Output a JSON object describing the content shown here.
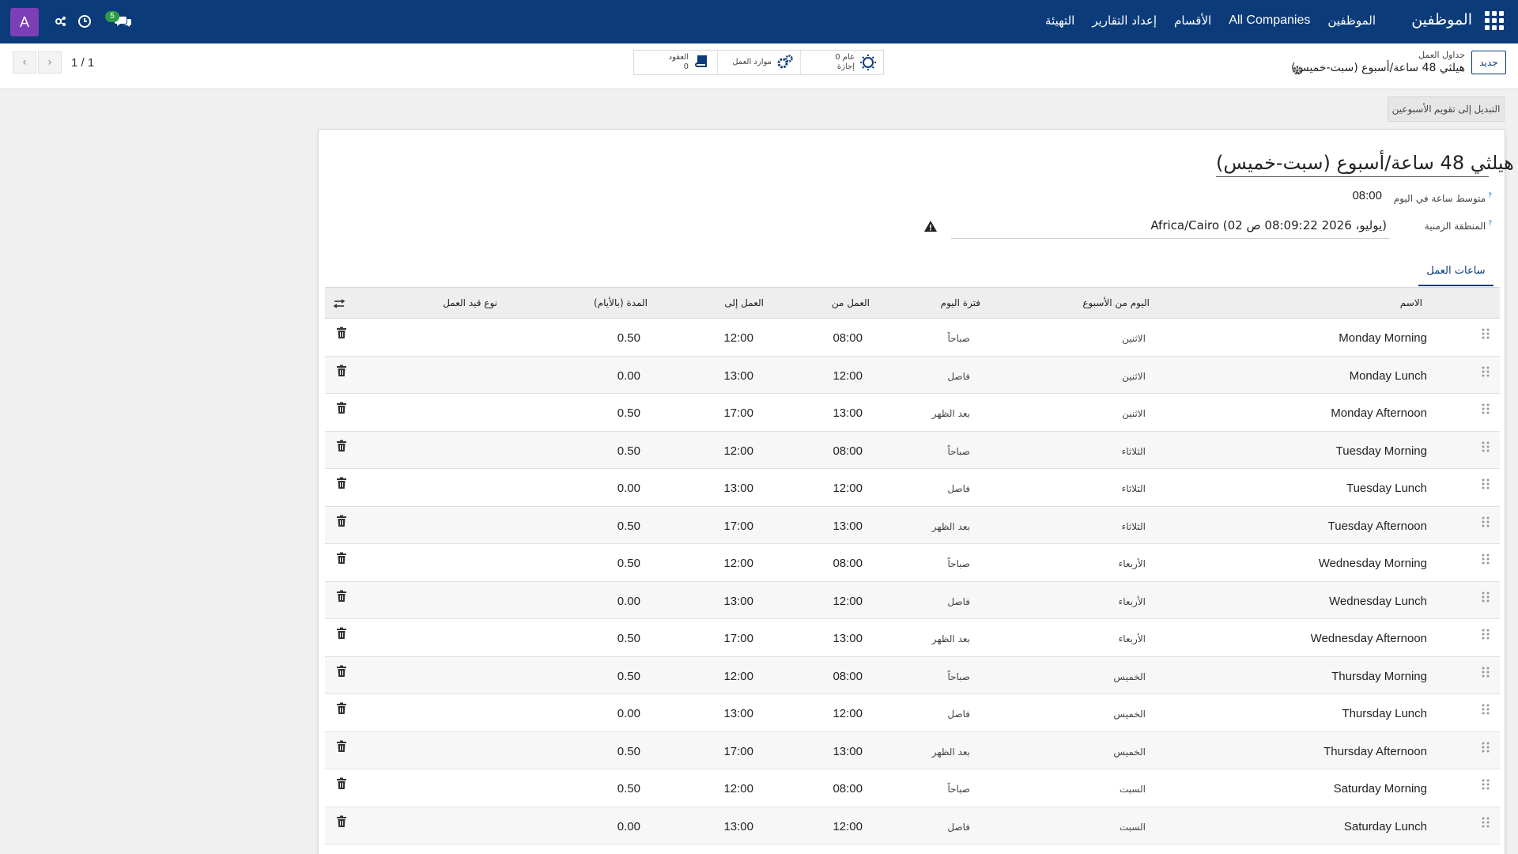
{
  "navbar": {
    "brand": "الموظفين",
    "menu": [
      {
        "label": "الموظفين"
      },
      {
        "label": "All Companies"
      },
      {
        "label": "الأقسام"
      },
      {
        "label": "إعداد التقارير"
      },
      {
        "label": "التهيئة"
      }
    ],
    "avatar_letter": "A",
    "chat_badge": "5",
    "icons": [
      "apps-grid-icon",
      "settings-share-icon",
      "clock-icon",
      "chat-icon"
    ]
  },
  "control_panel": {
    "new_label": "جديد",
    "breadcrumb_parent": "جداول العمل",
    "breadcrumb_current": "هيلثي 48 ساعة/أسبوع (سبت-خميس)",
    "stats": [
      {
        "value": "0 عام",
        "label": "إجازة",
        "icon": "sun-icon"
      },
      {
        "value": "",
        "label": "موارد العمل",
        "icon": "gears-icon"
      },
      {
        "value": "0",
        "label": "العقود",
        "icon": "book-icon"
      }
    ],
    "pager": "1 / 1"
  },
  "switch_button": "التبديل إلى تقويم الأسبوعين",
  "form": {
    "title": "هيلثي 48 ساعة/أسبوع (سبت-خميس)",
    "avg_hours_label": "متوسط ساعة في اليوم",
    "avg_hours_value": "08:00",
    "timezone_label": "المنطقة الزمنية",
    "timezone_value": "Africa/Cairo (02 يوليو، 2026 08:09:22 ص)",
    "tab_label": "ساعات العمل"
  },
  "table": {
    "headers": {
      "name": "الاسم",
      "dayofweek": "اليوم من الأسبوع",
      "period": "فترة اليوم",
      "hour_from": "العمل من",
      "hour_to": "العمل إلى",
      "duration": "المدة (بالأيام)",
      "work_entry_type": "نوع قيد العمل"
    },
    "rows": [
      {
        "name": "Monday Morning",
        "day": "الاثنين",
        "period": "صباحاً",
        "from": "08:00",
        "to": "12:00",
        "duration": "0.50"
      },
      {
        "name": "Monday Lunch",
        "day": "الاثنين",
        "period": "فاصل",
        "from": "12:00",
        "to": "13:00",
        "duration": "0.00"
      },
      {
        "name": "Monday Afternoon",
        "day": "الاثنين",
        "period": "بعد الظهر",
        "from": "13:00",
        "to": "17:00",
        "duration": "0.50"
      },
      {
        "name": "Tuesday Morning",
        "day": "الثلاثاء",
        "period": "صباحاً",
        "from": "08:00",
        "to": "12:00",
        "duration": "0.50"
      },
      {
        "name": "Tuesday Lunch",
        "day": "الثلاثاء",
        "period": "فاصل",
        "from": "12:00",
        "to": "13:00",
        "duration": "0.00"
      },
      {
        "name": "Tuesday Afternoon",
        "day": "الثلاثاء",
        "period": "بعد الظهر",
        "from": "13:00",
        "to": "17:00",
        "duration": "0.50"
      },
      {
        "name": "Wednesday Morning",
        "day": "الأربعاء",
        "period": "صباحاً",
        "from": "08:00",
        "to": "12:00",
        "duration": "0.50"
      },
      {
        "name": "Wednesday Lunch",
        "day": "الأربعاء",
        "period": "فاصل",
        "from": "12:00",
        "to": "13:00",
        "duration": "0.00"
      },
      {
        "name": "Wednesday Afternoon",
        "day": "الأربعاء",
        "period": "بعد الظهر",
        "from": "13:00",
        "to": "17:00",
        "duration": "0.50"
      },
      {
        "name": "Thursday Morning",
        "day": "الخميس",
        "period": "صباحاً",
        "from": "08:00",
        "to": "12:00",
        "duration": "0.50"
      },
      {
        "name": "Thursday Lunch",
        "day": "الخميس",
        "period": "فاصل",
        "from": "12:00",
        "to": "13:00",
        "duration": "0.00"
      },
      {
        "name": "Thursday Afternoon",
        "day": "الخميس",
        "period": "بعد الظهر",
        "from": "13:00",
        "to": "17:00",
        "duration": "0.50"
      },
      {
        "name": "Saturday Morning",
        "day": "السبت",
        "period": "صباحاً",
        "from": "08:00",
        "to": "12:00",
        "duration": "0.50"
      },
      {
        "name": "Saturday Lunch",
        "day": "السبت",
        "period": "فاصل",
        "from": "12:00",
        "to": "13:00",
        "duration": "0.00"
      }
    ]
  },
  "colors": {
    "navbar": "#0b3b79",
    "avatar": "#7c3fb8",
    "badge": "#2e9b47"
  }
}
